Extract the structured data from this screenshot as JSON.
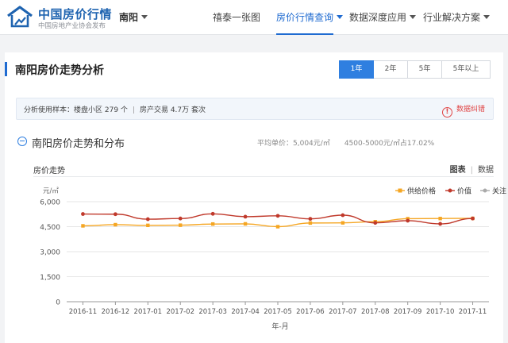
{
  "header": {
    "brand_name": "中国房价行情",
    "brand_sub": "中国房地产业协会发布",
    "city": "南阳",
    "nav": [
      "禧泰一张图",
      "房价行情查询",
      "数据深度应用",
      "行业解决方案"
    ],
    "active_nav": "房价行情查询",
    "accent_color": "#1f6bd1"
  },
  "page": {
    "title": "南阳房价走势分析",
    "range_tabs": [
      "1年",
      "2年",
      "5年",
      "5年以上"
    ],
    "selected_range": "1年"
  },
  "info": {
    "sample_label": "分析使用样本：",
    "sample_community": "楼盘小区 279 个",
    "sample_trade": "房产交易 4.7万 套次",
    "report_label": "数据纠错",
    "report_icon": "exclamation-icon"
  },
  "section": {
    "title": "南阳房价走势和分布",
    "avg_price": "平均单价：5,004元/㎡",
    "range_share": "4500-5000元/㎡占17.02%"
  },
  "chart_head": {
    "title": "房价走势",
    "view_chart": "图表",
    "view_data": "数据"
  },
  "chart_data": {
    "type": "line",
    "ylabel": "元/㎡",
    "xlabel": "年-月",
    "ylim": [
      0,
      6000
    ],
    "yticks": [
      "0",
      "1,500",
      "3,000",
      "4,500",
      "6,000"
    ],
    "ytick_values": [
      0,
      1500,
      3000,
      4500,
      6000
    ],
    "categories": [
      "2016-11",
      "2016-12",
      "2017-01",
      "2017-02",
      "2017-03",
      "2017-04",
      "2017-05",
      "2017-06",
      "2017-07",
      "2017-08",
      "2017-09",
      "2017-10",
      "2017-11"
    ],
    "legend_position": "top-right",
    "series": [
      {
        "name": "供给价格",
        "color": "#f5a623",
        "values": [
          4550,
          4620,
          4580,
          4590,
          4660,
          4670,
          4500,
          4720,
          4730,
          4800,
          4980,
          4990,
          5000
        ]
      },
      {
        "name": "价值",
        "color": "#c0392b",
        "values": [
          5260,
          5250,
          4950,
          4990,
          5270,
          5100,
          5150,
          4970,
          5190,
          4730,
          4860,
          4670,
          4990
        ]
      },
      {
        "name": "关注",
        "color": "#aaaaaa",
        "values": []
      }
    ]
  }
}
